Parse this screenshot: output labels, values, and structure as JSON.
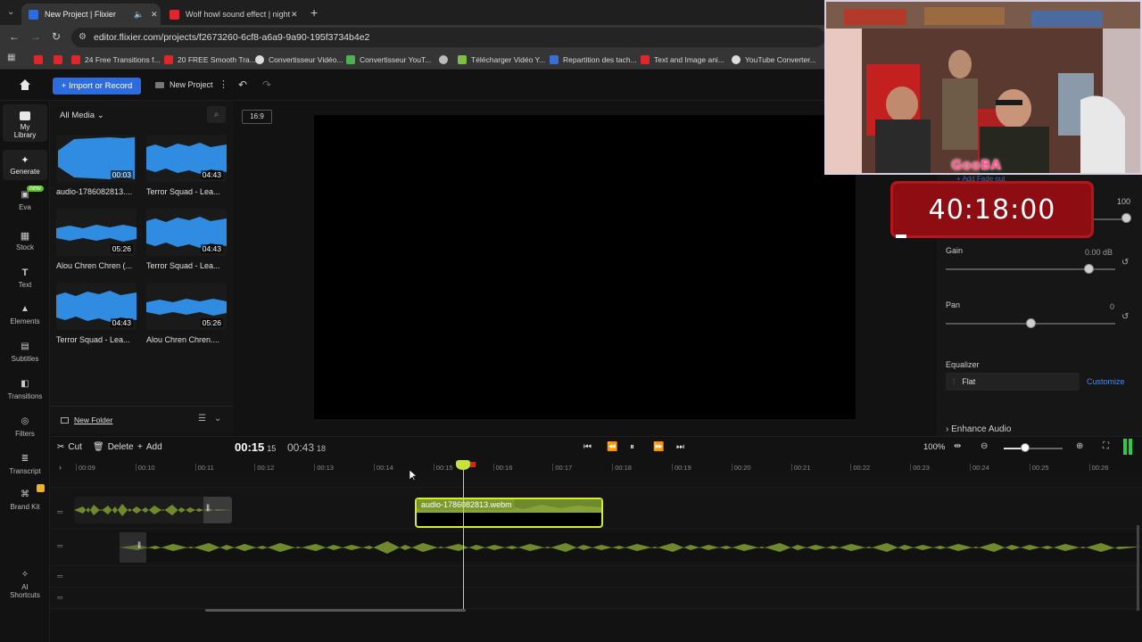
{
  "browser": {
    "tabs": [
      {
        "title": "New Project | Flixier",
        "active": true
      },
      {
        "title": "Wolf howl sound effect | night",
        "active": false
      }
    ],
    "url": "editor.flixier.com/projects/f2673260-6cf8-a6a9-9a90-195f3734b4e2",
    "bookmarks": [
      "24 Free Transitions f...",
      "20 FREE Smooth Tra...",
      "Convertisseur Vidéo...",
      "Convertisseur YouT...",
      "Télécharger Vidéo Y...",
      "Repartition des tach...",
      "Text and Image ani...",
      "YouTube Converter..."
    ]
  },
  "topbar": {
    "import_label": "Import or Record",
    "new_project_label": "New Project"
  },
  "nav": [
    {
      "label": "My Library",
      "icon": "folder-icon"
    },
    {
      "label": "Generate",
      "icon": "sparkle-icon"
    },
    {
      "label": "Eva",
      "icon": "chat-icon",
      "badge": "new"
    },
    {
      "label": "Stock",
      "icon": "grid-icon"
    },
    {
      "label": "Text",
      "icon": "text-icon"
    },
    {
      "label": "Elements",
      "icon": "shapes-icon"
    },
    {
      "label": "Subtitles",
      "icon": "subtitles-icon"
    },
    {
      "label": "Transitions",
      "icon": "transitions-icon"
    },
    {
      "label": "Filters",
      "icon": "filters-icon"
    },
    {
      "label": "Transcript",
      "icon": "transcript-icon"
    },
    {
      "label": "Brand Kit",
      "icon": "brand-icon"
    },
    {
      "label": "AI Shortcuts",
      "icon": "ai-icon"
    }
  ],
  "media": {
    "filter_label": "All Media",
    "items": [
      {
        "name": "audio-1786082813....",
        "duration": "00:03"
      },
      {
        "name": "Terror Squad - Lea...",
        "duration": "04:43"
      },
      {
        "name": "Alou Chren Chren (...",
        "duration": "05:26"
      },
      {
        "name": "Terror Squad - Lea...",
        "duration": "04:43"
      },
      {
        "name": "Terror Squad - Lea...",
        "duration": "04:43"
      },
      {
        "name": "Alou Chren Chren....",
        "duration": "05:26"
      }
    ],
    "new_folder_label": "New Folder"
  },
  "preview": {
    "aspect_label": "16:9"
  },
  "props": {
    "volume_value": "100",
    "gain_label": "Gain",
    "gain_value": "0.00 dB",
    "pan_label": "Pan",
    "pan_value": "0",
    "eq_label": "Equalizer",
    "eq_value": "Flat",
    "customize_label": "Customize",
    "enhance_label": "Enhance Audio",
    "add_fade_label": "+ Add Fade out"
  },
  "overlay": {
    "brand_text": "GooBA",
    "timer": "40:18:00"
  },
  "timeline": {
    "cut_label": "Cut",
    "delete_label": "Delete",
    "add_label": "Add",
    "current_time": "00:15",
    "current_frames": "15",
    "total_time": "00:43",
    "total_frames": "18",
    "zoom_label": "100%",
    "ticks": [
      "00:09",
      "00:10",
      "00:11",
      "00:12",
      "00:13",
      "00:14",
      "00:15",
      "00:16",
      "00:17",
      "00:18",
      "00:19",
      "00:20",
      "00:21",
      "00:22",
      "00:23",
      "00:24",
      "00:25",
      "00:26"
    ],
    "clip_name": "audio-1786082813.webm"
  },
  "colors": {
    "accent": "#2d6cdf",
    "playhead": "#c6e33a",
    "wave_blue": "#2f8ce0",
    "wave_green": "#6f8a2c",
    "timer_red": "#8d0d12"
  }
}
